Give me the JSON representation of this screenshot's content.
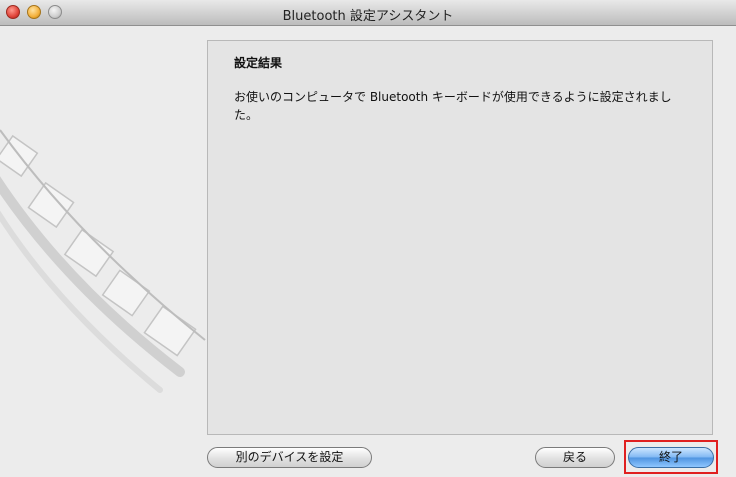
{
  "window": {
    "title": "Bluetooth 設定アシスタント"
  },
  "panel": {
    "heading": "設定結果",
    "message": "お使いのコンピュータで Bluetooth キーボードが使用できるように設定されました。"
  },
  "buttons": {
    "other_device": "別のデバイスを設定",
    "back": "戻る",
    "done": "終了"
  },
  "colors": {
    "highlight": "#e02020",
    "default_button": "#6aaaf0"
  }
}
